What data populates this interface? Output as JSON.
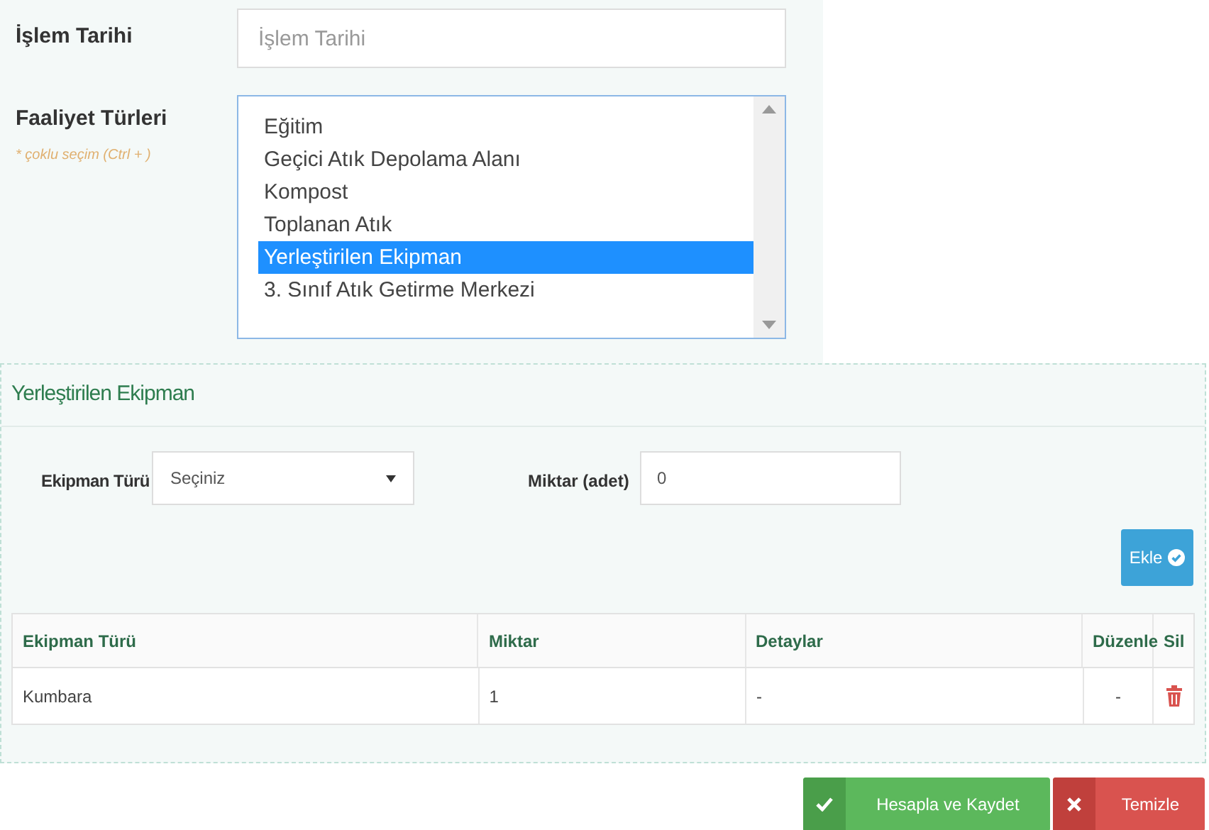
{
  "date_field": {
    "label": "İşlem Tarihi",
    "placeholder": "İşlem Tarihi"
  },
  "activity_types": {
    "label": "Faaliyet Türleri",
    "hint": "* çoklu seçim (Ctrl + )",
    "options": [
      {
        "label": "Eğitim",
        "selected": false
      },
      {
        "label": "Geçici Atık Depolama Alanı",
        "selected": false
      },
      {
        "label": "Kompost",
        "selected": false
      },
      {
        "label": "Toplanan Atık",
        "selected": false
      },
      {
        "label": "Yerleştirilen Ekipman",
        "selected": true
      },
      {
        "label": "3. Sınıf Atık Getirme Merkezi",
        "selected": false
      }
    ]
  },
  "panel": {
    "title": "Yerleştirilen Ekipman",
    "equipment_type": {
      "label": "Ekipman Türü",
      "value": "Seçiniz"
    },
    "quantity": {
      "label": "Miktar (adet)",
      "value": "0"
    },
    "add_button": "Ekle",
    "table": {
      "columns": [
        "Ekipman Türü",
        "Miktar",
        "Detaylar",
        "Düzenle",
        "Sil"
      ],
      "rows": [
        {
          "cells": [
            "Kumbara",
            "1",
            "-",
            "-"
          ]
        }
      ]
    }
  },
  "buttons": [
    {
      "kind": "save",
      "label": "Hesapla ve Kaydet"
    },
    {
      "kind": "clear",
      "label": "Temizle"
    }
  ]
}
